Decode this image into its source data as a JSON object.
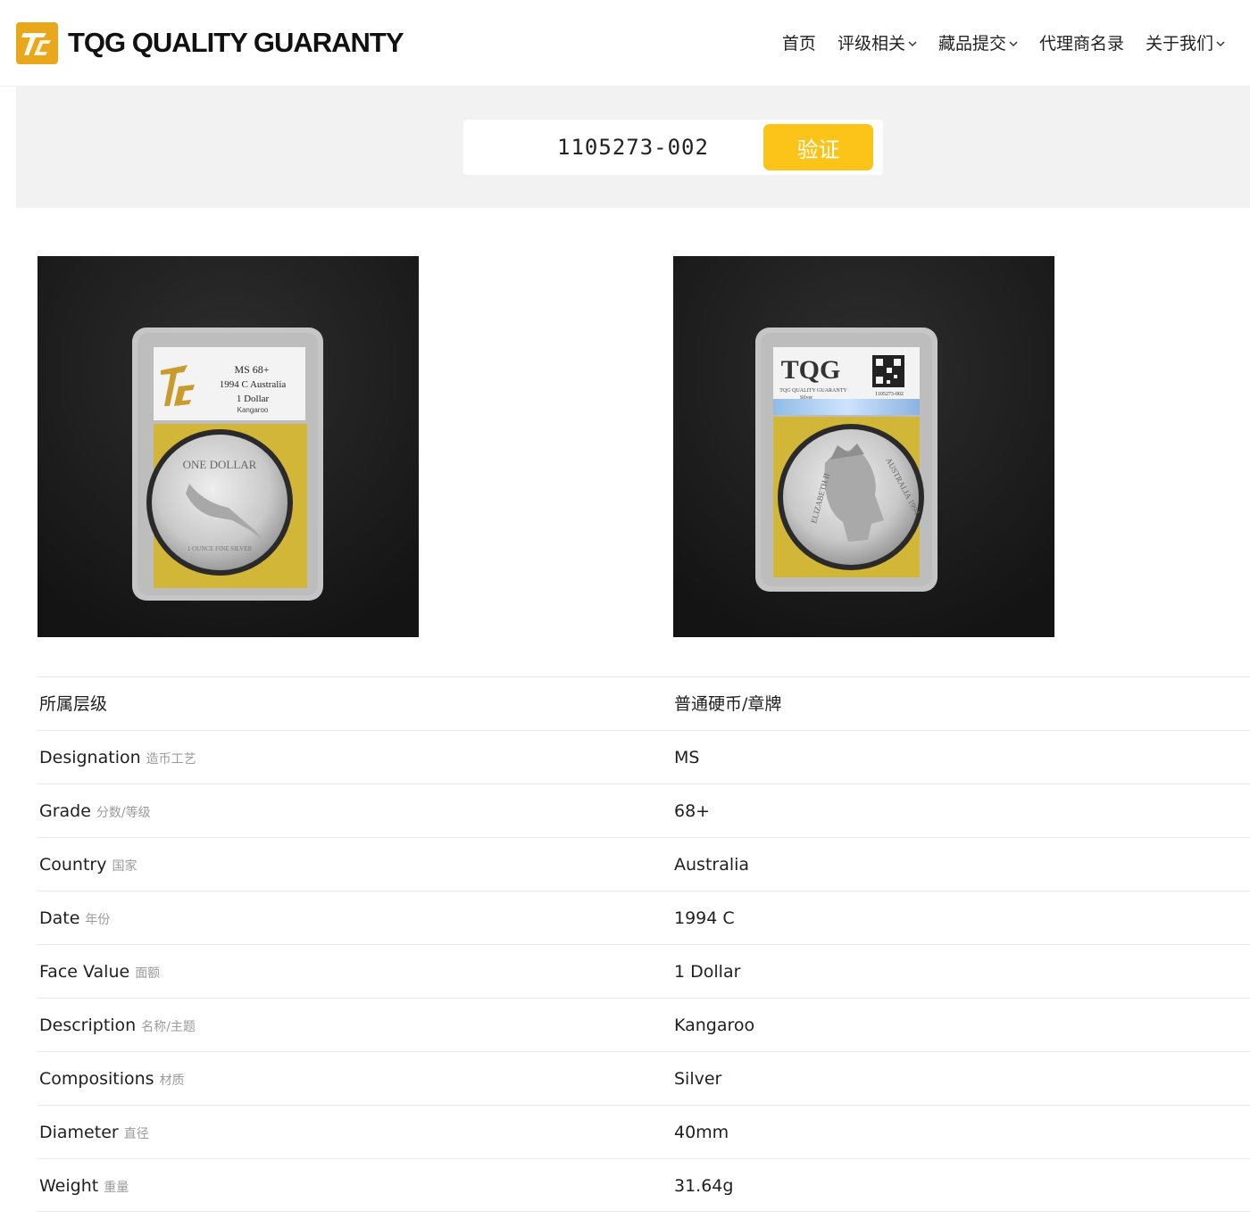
{
  "brand": {
    "name": "TQG QUALITY GUARANTY",
    "accent_color": "#e9a81c"
  },
  "nav": {
    "items": [
      {
        "label": "首页",
        "dropdown": false
      },
      {
        "label": "评级相关",
        "dropdown": true
      },
      {
        "label": "藏品提交",
        "dropdown": true
      },
      {
        "label": "代理商名录",
        "dropdown": false
      },
      {
        "label": "关于我们",
        "dropdown": true
      }
    ]
  },
  "search": {
    "value": "1105273-002",
    "button_label": "验证",
    "button_color": "#fcc419"
  },
  "photos": {
    "front": {
      "icon": "coin-front-image",
      "slab_label_lines": [
        "MS 68+",
        "1994 C Australia",
        "1 Dollar",
        "Kangaroo"
      ],
      "coin_text": [
        "ONE DOLLAR",
        "1 OUNCE FINE SILVER"
      ]
    },
    "back": {
      "icon": "coin-back-image",
      "slab_label_lines": [
        "TQG",
        "TQG QUALITY GUARANTY",
        "Silver",
        "1105273-002"
      ],
      "coin_text": [
        "ELIZABETH II",
        "AUSTRALIA 1994"
      ]
    }
  },
  "details": {
    "rows": [
      {
        "label": "所属层级",
        "sub": "",
        "value": "普通硬币/章牌"
      },
      {
        "label": "Designation",
        "sub": "造币工艺",
        "value": "MS"
      },
      {
        "label": "Grade",
        "sub": "分数/等级",
        "value": "68+"
      },
      {
        "label": "Country",
        "sub": "国家",
        "value": "Australia"
      },
      {
        "label": "Date",
        "sub": "年份",
        "value": "1994 C"
      },
      {
        "label": "Face Value",
        "sub": "面额",
        "value": "1 Dollar"
      },
      {
        "label": "Description",
        "sub": "名称/主题",
        "value": "Kangaroo"
      },
      {
        "label": "Compositions",
        "sub": "材质",
        "value": "Silver"
      },
      {
        "label": "Diameter",
        "sub": "直径",
        "value": "40mm"
      },
      {
        "label": "Weight",
        "sub": "重量",
        "value": "31.64g"
      }
    ]
  }
}
